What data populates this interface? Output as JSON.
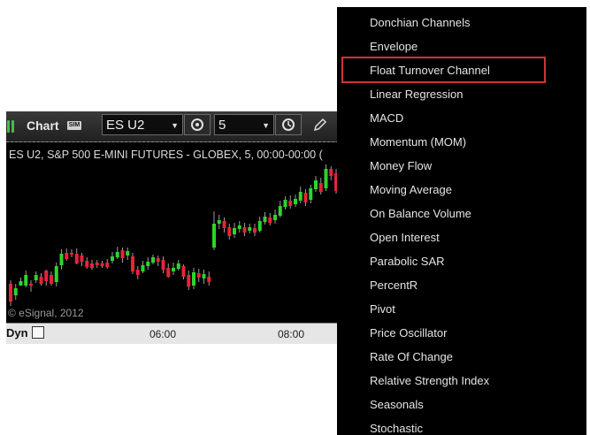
{
  "chart": {
    "title": "Chart",
    "sim_badge": "SIM",
    "symbol": "ES U2",
    "interval": "5",
    "description": "ES U2, S&P 500 E-MINI FUTURES - GLOBEX, 5, 00:00-00:00 (",
    "copyright": "© eSignal, 2012",
    "axis_mode": "Dyn",
    "time_ticks": [
      "06:00",
      "08:00"
    ],
    "colors": {
      "up": "#2bd62b",
      "down": "#e8233a",
      "background": "#000000"
    },
    "candles": [
      {
        "o": 320,
        "c": 340,
        "h": 316,
        "l": 345
      },
      {
        "o": 333,
        "c": 325,
        "h": 320,
        "l": 338
      },
      {
        "o": 322,
        "c": 317,
        "h": 313,
        "l": 322
      },
      {
        "o": 322,
        "c": 310,
        "h": 305,
        "l": 324
      },
      {
        "o": 320,
        "c": 322,
        "h": 316,
        "l": 329
      },
      {
        "o": 316,
        "c": 310,
        "h": 306,
        "l": 319
      },
      {
        "o": 312,
        "c": 320,
        "h": 308,
        "l": 322
      },
      {
        "o": 305,
        "c": 317,
        "h": 304,
        "l": 322
      },
      {
        "o": 310,
        "c": 320,
        "h": 306,
        "l": 322
      },
      {
        "o": 318,
        "c": 300,
        "h": 296,
        "l": 323
      },
      {
        "o": 299,
        "c": 286,
        "h": 281,
        "l": 304
      },
      {
        "o": 285,
        "c": 292,
        "h": 280,
        "l": 294
      },
      {
        "o": 285,
        "c": 287,
        "h": 281,
        "l": 290
      },
      {
        "o": 286,
        "c": 297,
        "h": 280,
        "l": 298
      },
      {
        "o": 288,
        "c": 295,
        "h": 285,
        "l": 300
      },
      {
        "o": 294,
        "c": 301,
        "h": 290,
        "l": 303
      },
      {
        "o": 297,
        "c": 302,
        "h": 293,
        "l": 304
      },
      {
        "o": 296,
        "c": 299,
        "h": 293,
        "l": 302
      },
      {
        "o": 297,
        "c": 300,
        "h": 294,
        "l": 302
      },
      {
        "o": 296,
        "c": 301,
        "h": 292,
        "l": 303
      },
      {
        "o": 294,
        "c": 289,
        "h": 284,
        "l": 297
      },
      {
        "o": 290,
        "c": 284,
        "h": 278,
        "l": 292
      },
      {
        "o": 282,
        "c": 291,
        "h": 279,
        "l": 296
      },
      {
        "o": 288,
        "c": 283,
        "h": 279,
        "l": 293
      },
      {
        "o": 289,
        "c": 306,
        "h": 285,
        "l": 309
      },
      {
        "o": 304,
        "c": 310,
        "h": 300,
        "l": 315
      },
      {
        "o": 306,
        "c": 299,
        "h": 294,
        "l": 308
      },
      {
        "o": 300,
        "c": 295,
        "h": 290,
        "l": 304
      },
      {
        "o": 296,
        "c": 290,
        "h": 287,
        "l": 298
      },
      {
        "o": 291,
        "c": 295,
        "h": 288,
        "l": 300
      },
      {
        "o": 293,
        "c": 304,
        "h": 289,
        "l": 308
      },
      {
        "o": 302,
        "c": 312,
        "h": 297,
        "l": 313
      },
      {
        "o": 306,
        "c": 302,
        "h": 296,
        "l": 310
      },
      {
        "o": 303,
        "c": 297,
        "h": 293,
        "l": 305
      },
      {
        "o": 300,
        "c": 312,
        "h": 298,
        "l": 315
      },
      {
        "o": 310,
        "c": 323,
        "h": 305,
        "l": 327
      },
      {
        "o": 322,
        "c": 307,
        "h": 302,
        "l": 326
      },
      {
        "o": 308,
        "c": 313,
        "h": 303,
        "l": 318
      },
      {
        "o": 314,
        "c": 309,
        "h": 304,
        "l": 320
      },
      {
        "o": 312,
        "c": 318,
        "h": 306,
        "l": 322
      },
      {
        "o": 279,
        "c": 252,
        "h": 238,
        "l": 282
      },
      {
        "o": 252,
        "c": 248,
        "h": 242,
        "l": 258
      },
      {
        "o": 249,
        "c": 257,
        "h": 245,
        "l": 262
      },
      {
        "o": 256,
        "c": 266,
        "h": 252,
        "l": 270
      },
      {
        "o": 264,
        "c": 257,
        "h": 251,
        "l": 268
      },
      {
        "o": 258,
        "c": 254,
        "h": 249,
        "l": 262
      },
      {
        "o": 256,
        "c": 262,
        "h": 251,
        "l": 266
      },
      {
        "o": 260,
        "c": 256,
        "h": 252,
        "l": 263
      },
      {
        "o": 257,
        "c": 262,
        "h": 252,
        "l": 266
      },
      {
        "o": 260,
        "c": 249,
        "h": 244,
        "l": 262
      },
      {
        "o": 250,
        "c": 244,
        "h": 239,
        "l": 253
      },
      {
        "o": 245,
        "c": 251,
        "h": 240,
        "l": 254
      },
      {
        "o": 248,
        "c": 242,
        "h": 236,
        "l": 252
      },
      {
        "o": 243,
        "c": 232,
        "h": 226,
        "l": 245
      },
      {
        "o": 233,
        "c": 225,
        "h": 221,
        "l": 236
      },
      {
        "o": 226,
        "c": 232,
        "h": 220,
        "l": 235
      },
      {
        "o": 230,
        "c": 224,
        "h": 219,
        "l": 233
      },
      {
        "o": 226,
        "c": 216,
        "h": 210,
        "l": 229
      },
      {
        "o": 217,
        "c": 228,
        "h": 213,
        "l": 232
      },
      {
        "o": 225,
        "c": 212,
        "h": 208,
        "l": 229
      },
      {
        "o": 213,
        "c": 203,
        "h": 198,
        "l": 216
      },
      {
        "o": 206,
        "c": 216,
        "h": 200,
        "l": 219
      },
      {
        "o": 212,
        "c": 190,
        "h": 185,
        "l": 215
      },
      {
        "o": 190,
        "c": 198,
        "h": 187,
        "l": 203
      },
      {
        "o": 195,
        "c": 215,
        "h": 190,
        "l": 218
      }
    ]
  },
  "menu": {
    "items": [
      "Donchian Channels",
      "Envelope",
      "Float Turnover Channel",
      "Linear Regression",
      "MACD",
      "Momentum (MOM)",
      "Money Flow",
      "Moving Average",
      "On Balance Volume",
      "Open Interest",
      "Parabolic SAR",
      "PercentR",
      "Pivot",
      "Price Oscillator",
      "Rate Of Change",
      "Relative Strength Index",
      "Seasonals",
      "Stochastic"
    ],
    "highlighted_item": "Float Turnover Channel",
    "highlight_color": "#d23232"
  }
}
